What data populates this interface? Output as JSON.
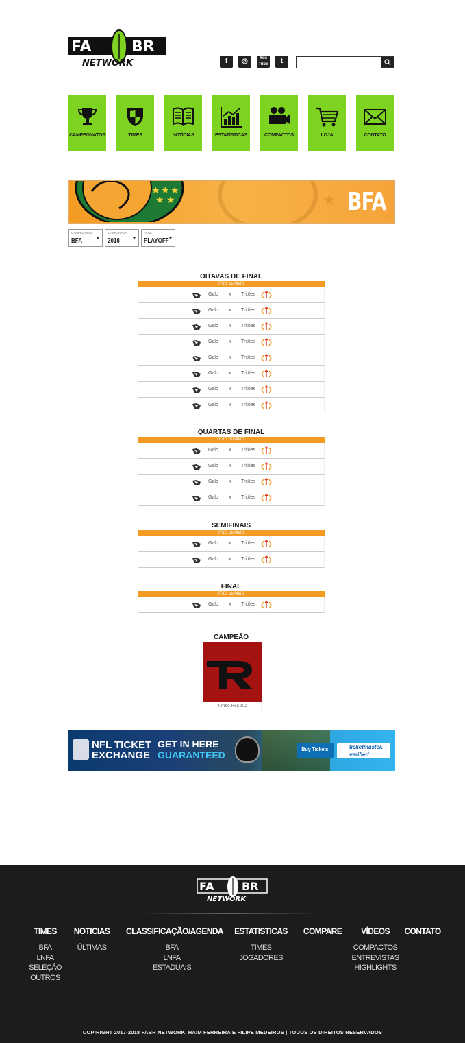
{
  "header": {
    "logo_top": "FA",
    "logo_top2": "BR",
    "logo_bottom": "NETWORK",
    "social": [
      "facebook-icon",
      "instagram-icon",
      "youtube-icon",
      "twitter-icon"
    ],
    "search_placeholder": ""
  },
  "nav": [
    {
      "label": "CAMPEONATOS",
      "icon": "trophy-icon"
    },
    {
      "label": "TIMES",
      "icon": "shield-icon"
    },
    {
      "label": "NOTÍCIAS",
      "icon": "book-icon"
    },
    {
      "label": "ESTATÍSTICAS",
      "icon": "chart-icon"
    },
    {
      "label": "COMPACTOS",
      "icon": "video-camera-icon"
    },
    {
      "label": "LOJA",
      "icon": "cart-icon"
    },
    {
      "label": "CONTATO",
      "icon": "envelope-icon"
    }
  ],
  "banner": {
    "text": "BFA"
  },
  "filters": [
    {
      "caption": "CAMPEONATO",
      "value": "BFA"
    },
    {
      "caption": "TEMPORADA",
      "value": "2018"
    },
    {
      "caption": "FASE",
      "value": "PLAYOFF"
    }
  ],
  "rounds": [
    {
      "title": "OITAVAS DE FINAL",
      "date": "07/01 ou 08/01",
      "matches": [
        {
          "home": "Galo",
          "vs": "x",
          "away": "Tritões"
        },
        {
          "home": "Galo",
          "vs": "x",
          "away": "Tritões"
        },
        {
          "home": "Galo",
          "vs": "x",
          "away": "Tritões"
        },
        {
          "home": "Galo",
          "vs": "x",
          "away": "Tritões"
        },
        {
          "home": "Galo",
          "vs": "x",
          "away": "Tritões"
        },
        {
          "home": "Galo",
          "vs": "x",
          "away": "Tritões"
        },
        {
          "home": "Galo",
          "vs": "x",
          "away": "Tritões"
        },
        {
          "home": "Galo",
          "vs": "x",
          "away": "Tritões"
        }
      ]
    },
    {
      "title": "QUARTAS DE FINAL",
      "date": "07/01 ou 08/01",
      "matches": [
        {
          "home": "Galo",
          "vs": "x",
          "away": "Tritões"
        },
        {
          "home": "Galo",
          "vs": "x",
          "away": "Tritões"
        },
        {
          "home": "Galo",
          "vs": "x",
          "away": "Tritões"
        },
        {
          "home": "Galo",
          "vs": "x",
          "away": "Tritões"
        }
      ]
    },
    {
      "title": "SEMIFINAIS",
      "date": "07/01 ou 08/01",
      "matches": [
        {
          "home": "Galo",
          "vs": "x",
          "away": "Tritões"
        },
        {
          "home": "Galo",
          "vs": "x",
          "away": "Tritões"
        }
      ]
    },
    {
      "title": "FINAL",
      "date": "07/01 ou 08/01",
      "matches": [
        {
          "home": "Galo",
          "vs": "x",
          "away": "Tritões"
        }
      ]
    }
  ],
  "champion": {
    "title": "CAMPEÃO",
    "name": "Timbó Rex-SC",
    "logo_text": "TR"
  },
  "ad": {
    "line1a": "NFL TICKET",
    "line1b": "EXCHANGE",
    "line2a": "GET IN HERE",
    "line2b": "GUARANTEED",
    "buy": "Buy Tickets",
    "tm1": "ticketmaster.",
    "tm2": "verified"
  },
  "footer": {
    "columns": [
      {
        "heading": "TIMES",
        "links": [
          "BFA",
          "LNFA",
          "SELEÇÃO",
          "OUTROS"
        ]
      },
      {
        "heading": "NOTICIAS",
        "links": [
          "ÚLTIMAS"
        ]
      },
      {
        "heading": "CLASSIFICAÇÃO/AGENDA",
        "links": [
          "BFA",
          "LNFA",
          "ESTADUAIS"
        ]
      },
      {
        "heading": "ESTATISTICAS",
        "links": [
          "TIMES",
          "JOGADORES"
        ]
      },
      {
        "heading": "COMPARE",
        "links": []
      },
      {
        "heading": "VÍDEOS",
        "links": [
          "COMPACTOS",
          "ENTREVISTAS",
          "HIGHLIGHTS"
        ]
      },
      {
        "heading": "CONTATO",
        "links": []
      }
    ],
    "copyright": "COPIRIGHT 2017-2018 FABR NETWORK, HAIM FERREIRA E FILIPE MEDEIROS  |  TODOS OS DIREITOS RESERVADOS"
  },
  "colors": {
    "accent_green": "#7ed321",
    "accent_orange": "#f39b23",
    "footer_bg": "#1c1c1e"
  }
}
